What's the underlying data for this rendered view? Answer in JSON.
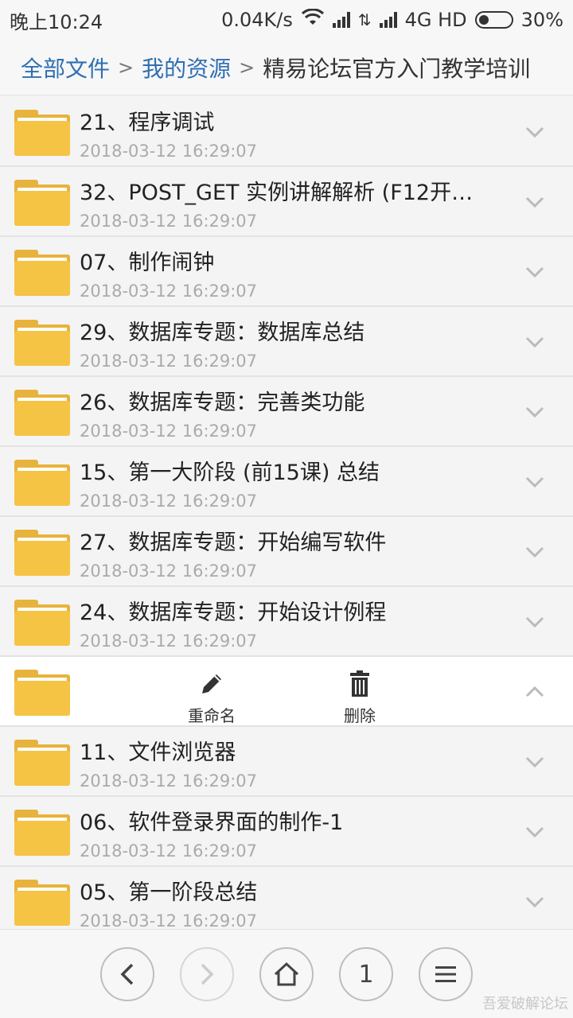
{
  "statusbar": {
    "time": "晚上10:24",
    "speed": "0.04K/s",
    "network": "4G HD",
    "battery": "30%"
  },
  "breadcrumb": {
    "root": "全部文件",
    "parent": "我的资源",
    "current": "精易论坛官方入门教学培训",
    "separator": ">"
  },
  "files": [
    {
      "name": "21、程序调试",
      "date": "2018-03-12 16:29:07"
    },
    {
      "name": "32、POST_GET 实例讲解解析 (F12开…",
      "date": "2018-03-12 16:29:07"
    },
    {
      "name": "07、制作闹钟",
      "date": "2018-03-12 16:29:07"
    },
    {
      "name": "29、数据库专题：数据库总结",
      "date": "2018-03-12 16:29:07"
    },
    {
      "name": "26、数据库专题：完善类功能",
      "date": "2018-03-12 16:29:07"
    },
    {
      "name": "15、第一大阶段 (前15课) 总结",
      "date": "2018-03-12 16:29:07"
    },
    {
      "name": "27、数据库专题：开始编写软件",
      "date": "2018-03-12 16:29:07"
    },
    {
      "name": "24、数据库专题：开始设计例程",
      "date": "2018-03-12 16:29:07"
    },
    {
      "name": "11、文件浏览器",
      "date": "2018-03-12 16:29:07"
    },
    {
      "name": "06、软件登录界面的制作-1",
      "date": "2018-03-12 16:29:07"
    },
    {
      "name": "05、第一阶段总结",
      "date": "2018-03-12 16:29:07"
    }
  ],
  "expanded_actions": {
    "rename": "重命名",
    "delete": "删除"
  },
  "bottombar": {
    "page": "1"
  },
  "watermark": "吾爱破解论坛",
  "colors": {
    "link": "#2f6fb3",
    "folder": "#f5c445",
    "date": "#aaaaaa"
  }
}
